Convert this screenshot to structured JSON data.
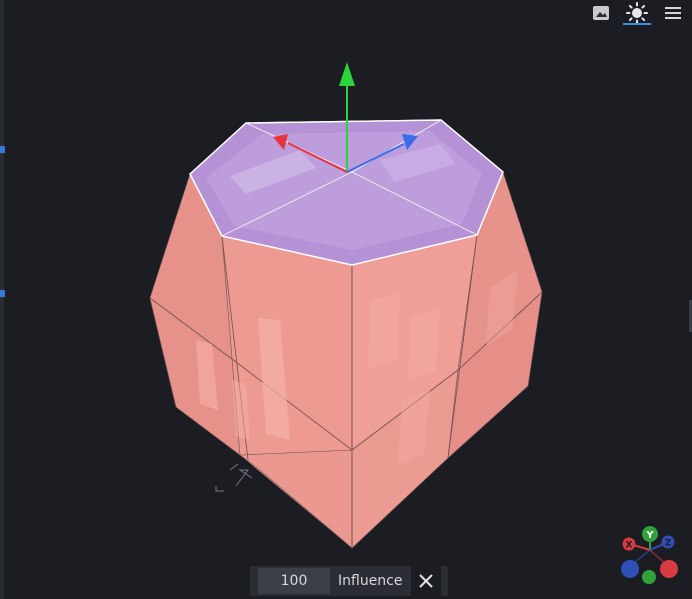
{
  "toolbar": {
    "buttons": [
      {
        "name": "image-icon",
        "active": false
      },
      {
        "name": "sun-icon",
        "active": true
      },
      {
        "name": "menu-icon",
        "active": false
      }
    ]
  },
  "influence": {
    "value": "100",
    "label": "Influence",
    "close_icon": "close-icon"
  },
  "axis_gizmo": {
    "x_label": "X",
    "y_label": "Y",
    "z_label": "Z",
    "x_color": "#d93a42",
    "y_color": "#2fa23a",
    "z_color": "#2f4fb8"
  },
  "colors": {
    "background": "#1c1d22",
    "model_side": "#e9918a",
    "model_top_selected": "#b592d6",
    "gizmo_x": "#e8323c",
    "gizmo_y": "#2ad43a",
    "gizmo_z": "#3a6ee8"
  }
}
